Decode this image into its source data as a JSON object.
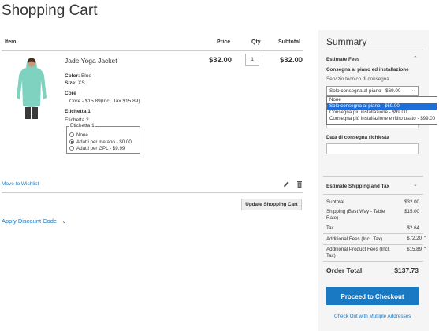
{
  "page": {
    "title": "Shopping Cart"
  },
  "table": {
    "headers": {
      "item": "Item",
      "price": "Price",
      "qty": "Qty",
      "subtotal": "Subtotal"
    }
  },
  "item": {
    "name": "Jade Yoga Jacket",
    "price": "$32.00",
    "qty": "1",
    "subtotal": "$32.00",
    "options": {
      "color_label": "Color:",
      "color_value": "Blue",
      "size_label": "Size:",
      "size_value": "XS",
      "core_label": "Core",
      "core_value": "Core - $15.89(Incl. Tax $15.89)",
      "etichetta1_label": "Etichetta 1",
      "etichetta2_label": "Etichetta 2",
      "legend": "Etichetta 1",
      "radios": [
        "None",
        "Adatti per metano - $0.00",
        "Adatti per GPL - $9.99"
      ],
      "selected_index": 1
    }
  },
  "actions": {
    "wishlist": "Move to Wishlist",
    "update": "Update Shopping Cart",
    "discount": "Apply Discount Code"
  },
  "summary": {
    "title": "Summary",
    "estimate_fees": "Estimate Fees",
    "delivery_label": "Consegna al piano ed installazione",
    "service_label": "Servizio tecnico di consegna",
    "select_value": "Solo consegna al piano - $69.00",
    "dropdown_options": [
      "None",
      "Solo consegna al piano - $69.00",
      "Consegna più installazione - $99.00",
      "Consegna più installazione e ritiro usato - $99.00"
    ],
    "dropdown_selected": 1,
    "date_label": "Data di consegna richiesta",
    "estimate_shipping": "Estimate Shipping and Tax",
    "totals": {
      "subtotal_label": "Subtotal",
      "subtotal_value": "$32.00",
      "shipping_label_1": "Shipping (Best Way - Table",
      "shipping_label_2": "Rate)",
      "shipping_value": "$15.00",
      "tax_label": "Tax",
      "tax_value": "$2.64",
      "add_fees_label": "Additional Fees (Incl. Tax)",
      "add_fees_value": "$72.20",
      "prod_fees_label_1": "Additional Product Fees (Incl.",
      "prod_fees_label_2": "Tax)",
      "prod_fees_value": "$15.89",
      "order_total_label": "Order Total",
      "order_total_value": "$137.73"
    },
    "checkout": "Proceed to Checkout",
    "multi_address": "Check Out with Multiple Addresses"
  },
  "colors": {
    "link": "#1979c3",
    "primary_button": "#1979c3",
    "dropdown_highlight": "#1e6fd9",
    "product": "#7fd1c0"
  },
  "icons": [
    "pencil-icon",
    "trash-icon",
    "chevron-down-icon",
    "chevron-up-icon"
  ]
}
